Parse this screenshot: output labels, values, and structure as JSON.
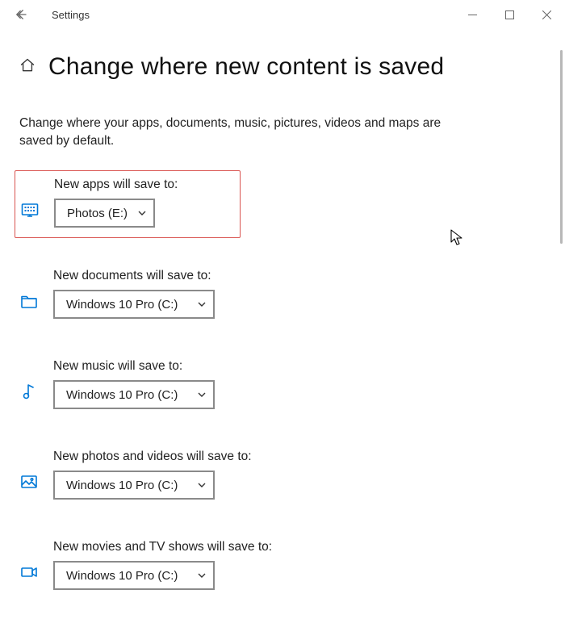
{
  "app_title": "Settings",
  "page_title": "Change where new content is saved",
  "description": "Change where your apps, documents, music, pictures, videos and maps are saved by default.",
  "sections": {
    "apps": {
      "label": "New apps will save to:",
      "value": "Photos (E:)"
    },
    "docs": {
      "label": "New documents will save to:",
      "value": "Windows 10 Pro (C:)"
    },
    "music": {
      "label": "New music will save to:",
      "value": "Windows 10 Pro (C:)"
    },
    "photos": {
      "label": "New photos and videos will save to:",
      "value": "Windows 10 Pro (C:)"
    },
    "movies": {
      "label": "New movies and TV shows will save to:",
      "value": "Windows 10 Pro (C:)"
    }
  }
}
